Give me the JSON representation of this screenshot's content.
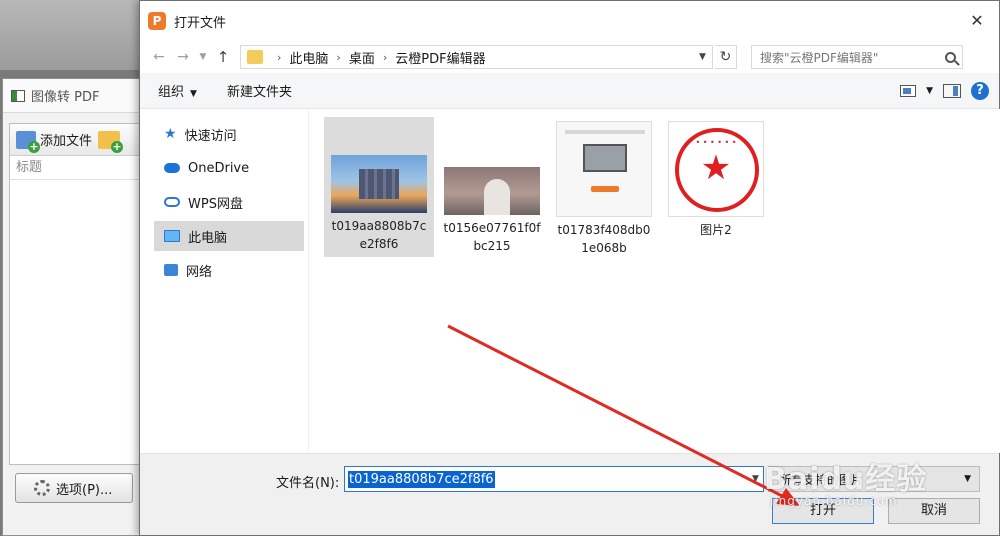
{
  "background_app": {
    "title": "图像转 PDF",
    "add_file_label": "添加文件",
    "column_header": "标题",
    "options_label": "选项(P)..."
  },
  "dialog": {
    "title": "打开文件",
    "close_glyph": "✕",
    "breadcrumbs": [
      "此电脑",
      "桌面",
      "云橙PDF编辑器"
    ],
    "search_placeholder": "搜索\"云橙PDF编辑器\"",
    "organize_label": "组织",
    "new_folder_label": "新建文件夹",
    "sidebar": [
      {
        "label": "快速访问",
        "icon": "star-icon"
      },
      {
        "label": "OneDrive",
        "icon": "cloud-icon"
      },
      {
        "label": "WPS网盘",
        "icon": "wps-cloud-icon"
      },
      {
        "label": "此电脑",
        "icon": "computer-icon",
        "selected": true
      },
      {
        "label": "网络",
        "icon": "network-icon"
      }
    ],
    "files": [
      {
        "name_line1": "t019aa8808b7c",
        "name_line2": "e2f8f6",
        "thumbnail": "city-skyline",
        "selected": true
      },
      {
        "name_line1": "t0156e07761f0f",
        "name_line2": "bc215",
        "thumbnail": "capitol-building"
      },
      {
        "name_line1": "t01783f408db0",
        "name_line2": "1e068b",
        "thumbnail": "webpage-screenshot"
      },
      {
        "name_line1": "图片2",
        "name_line2": "",
        "thumbnail": "red-seal"
      }
    ],
    "filename_label": "文件名(N):",
    "filename_value": "t019aa8808b7ce2f8f6",
    "filetype_value": "所有支持的图片",
    "open_label": "打开",
    "cancel_label": "取消"
  },
  "watermark": {
    "big": "Baidu经验",
    "small": "jingyan.baidu.com"
  },
  "colors": {
    "accent_blue": "#0a64d0",
    "arrow_red": "#e02b20",
    "seal_red": "#e02020"
  }
}
